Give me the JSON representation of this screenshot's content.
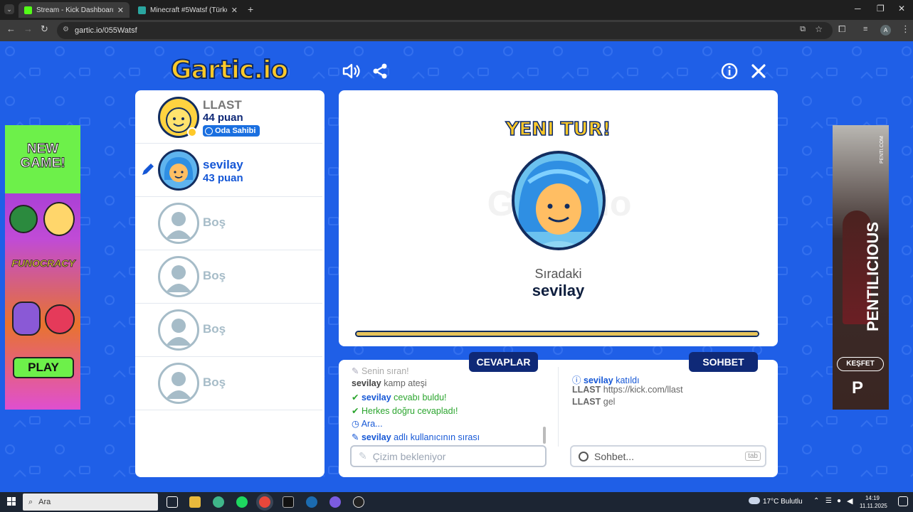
{
  "browser": {
    "tabs": [
      {
        "title": "Stream - Kick Dashboard",
        "active": true
      },
      {
        "title": "Minecraft #5Watsf (Türkçe) - G",
        "active": false
      }
    ],
    "url": "gartic.io/055Watsf"
  },
  "game": {
    "logo": "Gartic.io",
    "players": [
      {
        "name": "LLAST",
        "points": "44 puan",
        "badge": "Oda Sahibi"
      },
      {
        "name": "sevilay",
        "points": "43 puan"
      },
      {
        "name": "Boş"
      },
      {
        "name": "Boş"
      },
      {
        "name": "Boş"
      },
      {
        "name": "Boş"
      }
    ],
    "round_title": "YENI TUR!",
    "next_label": "Sıradaki",
    "next_player": "sevilay",
    "timer_fraction": 1.0,
    "answers_tab": "CEVAPLAR",
    "chat_tab": "SOHBET",
    "answers_log": [
      {
        "icon": "pencil",
        "user": "",
        "text": "Senin sıran!"
      },
      {
        "icon": "",
        "user": "sevilay",
        "text": "kamp ateşi"
      },
      {
        "icon": "check",
        "user": "sevilay",
        "text": "cevabı buldu!"
      },
      {
        "icon": "check",
        "user": "",
        "text": "Herkes doğru cevapladı!"
      },
      {
        "icon": "clock",
        "user": "",
        "text": "Ara..."
      },
      {
        "icon": "pencil",
        "user": "sevilay",
        "text": "adlı kullanıcının sırası"
      }
    ],
    "chat_log": [
      {
        "icon": "info",
        "user": "sevilay",
        "text": "katıldı"
      },
      {
        "icon": "",
        "user": "LLAST",
        "text": "https://kick.com/llast"
      },
      {
        "icon": "",
        "user": "LLAST",
        "text": "gel"
      }
    ],
    "answer_placeholder": "Çizim bekleniyor",
    "chat_placeholder": "Sohbet...",
    "chat_key_hint": "tab"
  },
  "ads": {
    "left": {
      "headline": "NEW GAME!",
      "brand": "FUNOCRACY",
      "cta": "PLAY"
    },
    "right": {
      "brand": "PENTILICIOUS",
      "cta": "KEŞFET",
      "site": "PENTI.COM"
    }
  },
  "taskbar": {
    "search": "Ara",
    "weather": "17°C",
    "weather_text": "Bulutlu",
    "time": "14:19",
    "date": "11.11.2025"
  },
  "colors": {
    "page_bg": "#1f5fe7",
    "accent": "#1557d6",
    "pill": "#0f2977",
    "timer": "#e7c35a"
  }
}
